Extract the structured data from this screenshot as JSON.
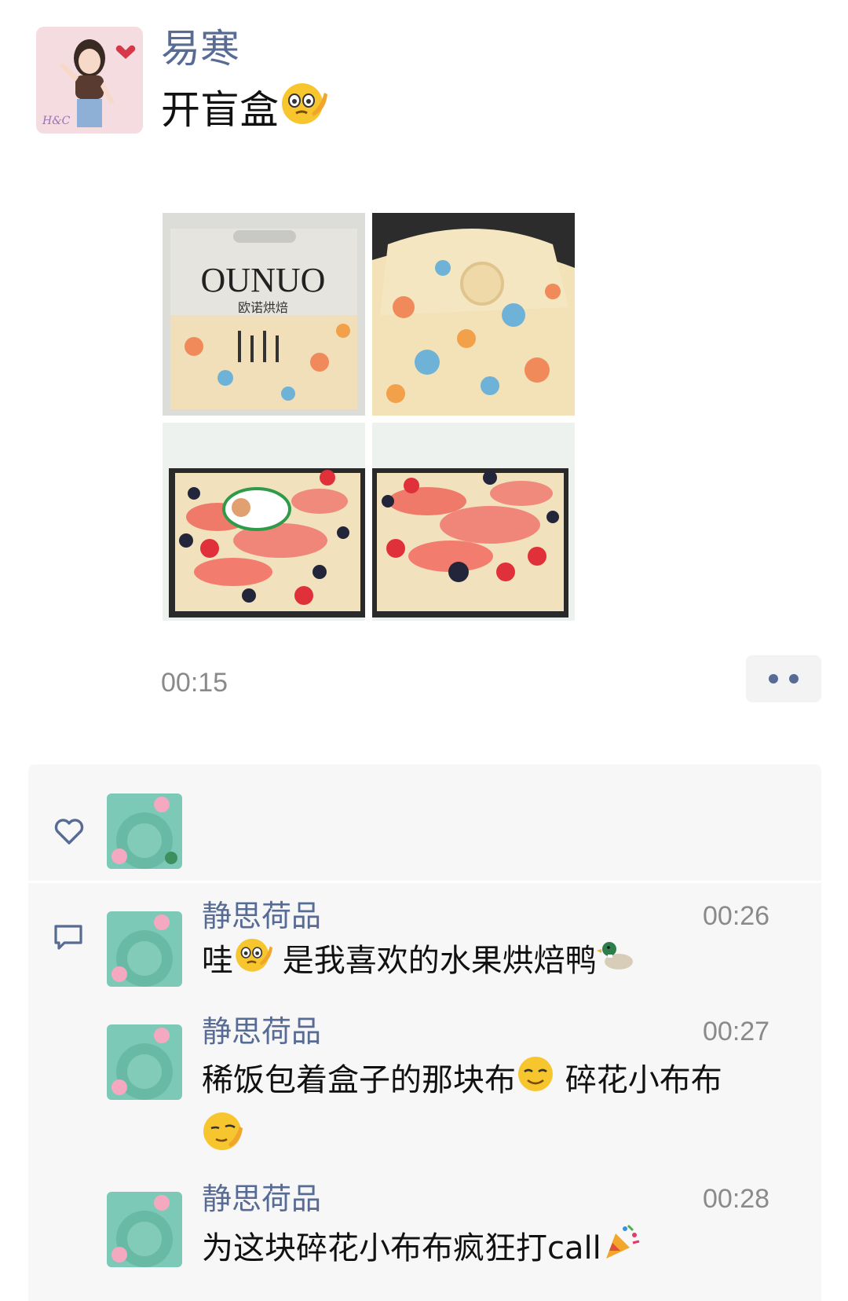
{
  "post": {
    "author": "易寒",
    "text": "开盲盒",
    "text_emoji": "smirk-emoji",
    "time": "00:15",
    "photos": [
      {
        "name": "ounuo-bag",
        "text": "OUNUO",
        "subtext": "欧诺烘焙"
      },
      {
        "name": "floral-wrap"
      },
      {
        "name": "fruit-cake-with-topper"
      },
      {
        "name": "fruit-cake"
      }
    ]
  },
  "likes": {
    "icon": "heart-icon"
  },
  "comments": [
    {
      "author": "静思荷品",
      "time": "00:26",
      "prefix": "哇",
      "text": " 是我喜欢的水果烘焙鸭",
      "emojis": [
        "smirk-emoji",
        "duck-emoji"
      ]
    },
    {
      "author": "静思荷品",
      "time": "00:27",
      "prefix": "稀饭包着盒子的那块布",
      "text": " 碎花小布布",
      "emojis": [
        "relieved-emoji",
        "wink-emoji"
      ]
    },
    {
      "author": "静思荷品",
      "time": "00:28",
      "prefix": "为这块碎花小布布疯狂打call",
      "text": "",
      "emojis": [
        "party-popper-emoji"
      ]
    }
  ],
  "colors": {
    "link": "#576b95",
    "panel": "#f7f7f7",
    "time": "#8a8a8a"
  }
}
